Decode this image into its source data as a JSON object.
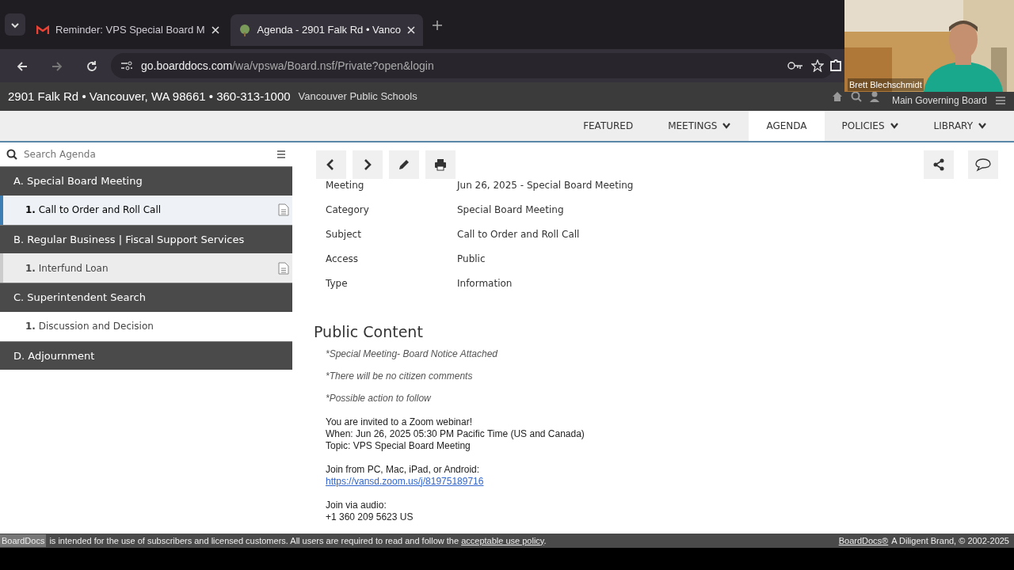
{
  "browser": {
    "tabs": [
      {
        "kind": "mail",
        "title": "Reminder: VPS Special Board M",
        "selected": false
      },
      {
        "kind": "tree",
        "title": "Agenda - 2901 Falk Rd • Vanco",
        "selected": true
      }
    ],
    "address": {
      "host": "go.boarddocs.com",
      "path": "/wa/vpswa/Board.nsf/Private?open&login"
    }
  },
  "site": {
    "contact": "2901 Falk Rd • Vancouver, WA 98661 • 360-313-1000",
    "organization": "Vancouver Public Schools",
    "board": "Main Governing Board",
    "nav": [
      {
        "label": "FEATURED",
        "dropdown": false,
        "selected": false
      },
      {
        "label": "MEETINGS",
        "dropdown": true,
        "selected": false
      },
      {
        "label": "AGENDA",
        "dropdown": false,
        "selected": true
      },
      {
        "label": "POLICIES",
        "dropdown": true,
        "selected": false
      },
      {
        "label": "LIBRARY",
        "dropdown": true,
        "selected": false
      }
    ]
  },
  "sidebar": {
    "search": {
      "placeholder": "Search Agenda"
    },
    "sections": [
      {
        "label": "A. Special Board Meeting",
        "items": [
          {
            "number": "1.",
            "label": "Call to Order and Roll Call",
            "selected": true,
            "hovered": false,
            "has_document": true
          }
        ]
      },
      {
        "label": "B. Regular Business | Fiscal Support Services",
        "items": [
          {
            "number": "1.",
            "label": "Interfund Loan",
            "selected": false,
            "hovered": true,
            "has_document": true
          }
        ]
      },
      {
        "label": "C. Superintendent Search",
        "items": [
          {
            "number": "1.",
            "label": "Discussion and Decision",
            "selected": false,
            "hovered": false,
            "has_document": false
          }
        ]
      },
      {
        "label": "D. Adjournment"
      }
    ]
  },
  "detail": {
    "fields": [
      {
        "label": "Meeting",
        "value": "Jun 26, 2025 - Special Board Meeting"
      },
      {
        "label": "Category",
        "value": "Special Board Meeting"
      },
      {
        "label": "Subject",
        "value": "Call to Order and Roll Call"
      },
      {
        "label": "Access",
        "value": "Public"
      },
      {
        "label": "Type",
        "value": "Information"
      }
    ],
    "content_title": "Public Content",
    "notes": [
      "*Special Meeting- Board Notice Attached",
      "*There will be no citizen comments",
      "*Possible action to follow"
    ],
    "invite": [
      "You are invited to a Zoom webinar!",
      "When: Jun 26, 2025 05:30 PM Pacific Time (US and Canada)",
      "Topic:  VPS Special Board Meeting"
    ],
    "join_label": "Join from PC, Mac, iPad, or Android:",
    "join_link": "https://vansd.zoom.us/j/81975189716",
    "audio_label": "Join via audio:",
    "audio_number": "+1 360 209 5623 US"
  },
  "footer": {
    "brand": "BoardDocs",
    "text": "is intended for the use of subscribers and licensed customers. All users are required to read and follow the",
    "policy_link": "acceptable use policy",
    "end": ".",
    "right_link": "BoardDocs®",
    "right_text": "A Diligent Brand, © 2002-2025"
  },
  "video": {
    "participant": "Brett Blechschmidt"
  }
}
